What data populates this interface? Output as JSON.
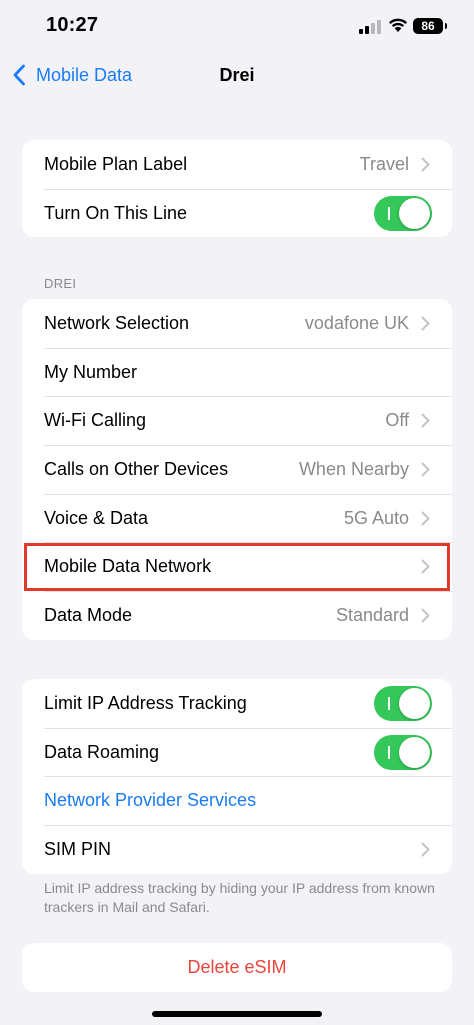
{
  "status": {
    "time": "10:27",
    "battery": "86",
    "icons": [
      "cellular-signal-icon",
      "wifi-icon",
      "battery-icon"
    ]
  },
  "nav": {
    "back_label": "Mobile Data",
    "title": "Drei"
  },
  "group1": {
    "plan_label": "Mobile Plan Label",
    "plan_value": "Travel",
    "turn_on_label": "Turn On This Line",
    "turn_on_state": true
  },
  "section_drei": {
    "header": "DREI",
    "network_selection": {
      "label": "Network Selection",
      "value": "vodafone UK"
    },
    "my_number": {
      "label": "My Number"
    },
    "wifi_calling": {
      "label": "Wi-Fi Calling",
      "value": "Off"
    },
    "calls_other": {
      "label": "Calls on Other Devices",
      "value": "When Nearby"
    },
    "voice_data": {
      "label": "Voice & Data",
      "value": "5G Auto"
    },
    "mobile_data_network": {
      "label": "Mobile Data Network"
    },
    "data_mode": {
      "label": "Data Mode",
      "value": "Standard"
    }
  },
  "group3": {
    "limit_ip": {
      "label": "Limit IP Address Tracking",
      "state": true
    },
    "data_roaming": {
      "label": "Data Roaming",
      "state": true
    },
    "provider_services": "Network Provider Services",
    "sim_pin": "SIM PIN",
    "footer": "Limit IP address tracking by hiding your IP address from known trackers in Mail and Safari."
  },
  "delete_esim": "Delete eSIM",
  "colors": {
    "accent": "#1a7cf5",
    "toggle_on": "#34c759",
    "destructive": "#e8453c",
    "highlight": "#e23a2a",
    "background": "#f2f2f7"
  }
}
